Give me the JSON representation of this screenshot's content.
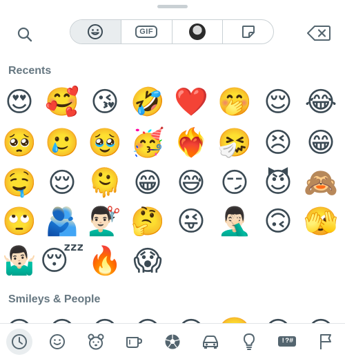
{
  "picker": {
    "tabs": [
      {
        "name": "emoji",
        "icon": "smiley-icon",
        "active": true
      },
      {
        "name": "gif",
        "label": "GIF"
      },
      {
        "name": "avatar",
        "icon": "avatar-icon"
      },
      {
        "name": "stickers",
        "icon": "sticker-icon"
      }
    ]
  },
  "sections": {
    "recents_title": "Recents",
    "smileys_title": "Smileys & People"
  },
  "recents": [
    "😍",
    "🥰",
    "😘",
    "🤣",
    "❤️",
    "🤭",
    "😌",
    "😂",
    "🥺",
    "🥲",
    "🥹",
    "🥳",
    "❤️‍🔥",
    "🤧",
    "😣",
    "😁",
    "🤤",
    "😌",
    "🫠",
    "😁",
    "😅",
    "😏",
    "😈",
    "🙈",
    "🙄",
    "🫂",
    "💇🏻‍♂️",
    "🤔",
    "😜",
    "🤦🏻‍♂️",
    "🙃",
    "🫣",
    "🤷🏻‍♂️",
    "😴",
    "🔥",
    "😱"
  ],
  "smileys_partial": [
    "😀",
    "😃",
    "😄",
    "😁",
    "😆",
    "🥹",
    "😅",
    "😂"
  ],
  "bottom_bar": {
    "symbols_label": "!?#",
    "categories": [
      "recent-clock-icon",
      "smiley-icon",
      "animal-icon",
      "food-cup-icon",
      "soccer-ball-icon",
      "car-icon",
      "lightbulb-icon",
      "symbols-icon",
      "flag-icon"
    ]
  },
  "colors": {
    "icon": "#54656f",
    "active_bg": "#e9edef",
    "border": "#c9d0d4"
  }
}
